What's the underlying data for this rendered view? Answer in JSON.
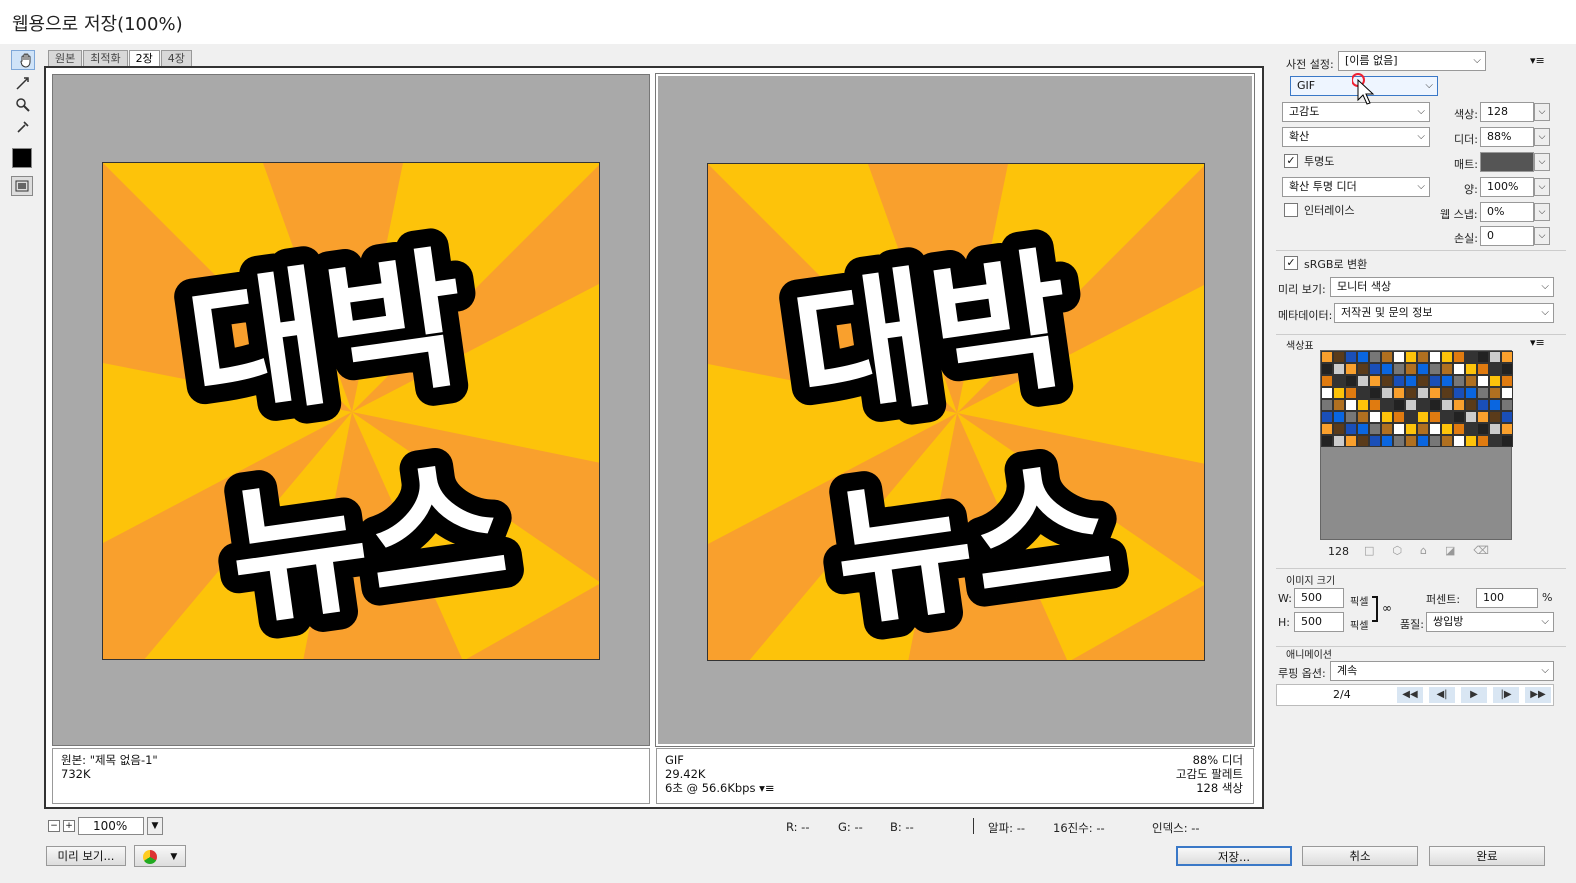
{
  "window": {
    "title": "웹용으로 저장(100%)"
  },
  "tabs": [
    "원본",
    "최적화",
    "2장",
    "4장"
  ],
  "active_tab": "2장",
  "preview": {
    "artwork_line1": "대박",
    "artwork_line2": "뉴스",
    "original": {
      "name": "원본: \"제목 없음-1\"",
      "size": "732K"
    },
    "optimized": {
      "format": "GIF",
      "size": "29.42K",
      "time": "6초 @ 56.6Kbps",
      "dither": "88% 디더",
      "palette": "고감도 팔레트",
      "colors": "128 색상"
    }
  },
  "colors": {
    "orange": "#f9a02d",
    "yellow": "#fdc30a",
    "accent": "#3a78c7"
  },
  "zoom": "100%",
  "readouts": {
    "r": "R: --",
    "g": "G: --",
    "b": "B: --",
    "alpha": "알파: --",
    "hex": "16진수: --",
    "index": "인덱스: --"
  },
  "buttons": {
    "preview": "미리 보기...",
    "save": "저장...",
    "cancel": "취소",
    "done": "완료"
  },
  "settings": {
    "preset_label": "사전 설정:",
    "preset": "[이름 없음]",
    "format": "GIF",
    "reduction": "고감도",
    "colors_label": "색상:",
    "colors": "128",
    "dither_algo": "확산",
    "dither_label": "디더:",
    "dither": "88%",
    "transparency": "투명도",
    "matte_label": "매트:",
    "trans_dither": "확산 투명 디더",
    "amount_label": "양:",
    "amount": "100%",
    "interlace": "인터레이스",
    "websnap_label": "웹 스냅:",
    "websnap": "0%",
    "lossy_label": "손실:",
    "lossy": "0",
    "srgb": "sRGB로 변환",
    "preview_label": "미리 보기:",
    "preview_value": "모니터 색상",
    "metadata_label": "메타데이터:",
    "metadata_value": "저작권 및 문의 정보"
  },
  "color_table": {
    "title": "색상표",
    "count": "128"
  },
  "image_size": {
    "title": "이미지 크기",
    "w_label": "W:",
    "w": "500",
    "h_label": "H:",
    "h": "500",
    "unit": "픽셀",
    "percent_label": "퍼센트:",
    "percent": "100",
    "pct_sign": "%",
    "quality_label": "품질:",
    "quality": "쌍입방"
  },
  "animation": {
    "title": "애니메이션",
    "loop_label": "루핑 옵션:",
    "loop": "계속",
    "frame": "2/4"
  }
}
